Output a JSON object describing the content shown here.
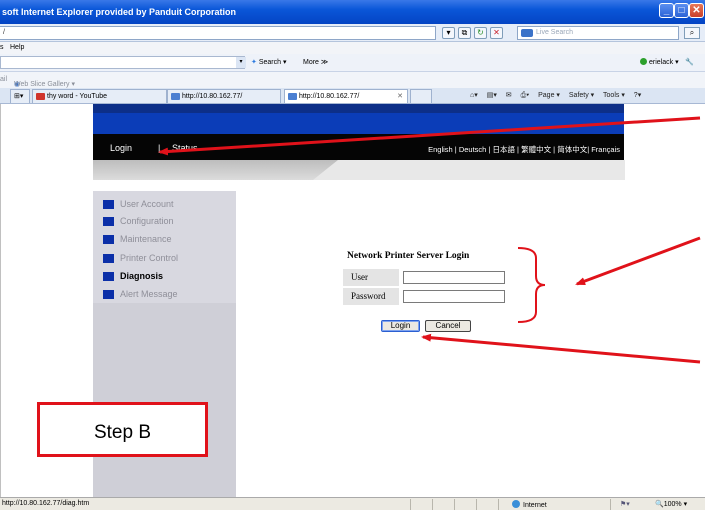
{
  "window": {
    "title": "soft Internet Explorer provided by Panduit Corporation",
    "buttons": {
      "minimize": "_",
      "maximize": "□",
      "close": "✕"
    }
  },
  "addressbar": {
    "url": "/",
    "search_placeholder": "Live Search"
  },
  "menubar": {
    "items": [
      "s",
      "Help"
    ]
  },
  "toolbar": {
    "search_label": "Search",
    "more_label": "More ≫",
    "user_label": "erielack",
    "arrow": "▾"
  },
  "favorites": {
    "items": [
      "ail",
      "Web Slice Gallery ▾"
    ]
  },
  "tabs": [
    {
      "label": "thy word - YouTube"
    },
    {
      "label": "http://10.80.162.77/"
    },
    {
      "label": "http://10.80.162.77/",
      "close": "✕"
    }
  ],
  "commandbar": {
    "items": [
      "Page ▾",
      "Safety ▾",
      "Tools ▾"
    ]
  },
  "printer_page": {
    "nav": {
      "login": "Login",
      "separator": "|",
      "status": "Status"
    },
    "languages": "English | Deutsch | 日本語 | 繁體中文 | 简体中文| Français",
    "sidebar": [
      {
        "label": "User Account",
        "active": false
      },
      {
        "label": "Configuration",
        "active": false
      },
      {
        "label": "Maintenance",
        "active": false
      },
      {
        "label": "Printer Control",
        "active": false
      },
      {
        "label": "Diagnosis",
        "active": true
      },
      {
        "label": "Alert Message",
        "active": false
      }
    ],
    "form": {
      "title": "Network Printer Server Login",
      "user_label": "User",
      "user_value": "",
      "password_label": "Password",
      "password_value": "",
      "login_button": "Login",
      "cancel_button": "Cancel"
    }
  },
  "annotation": {
    "step_label": "Step B",
    "color": "#e0121a"
  },
  "statusbar": {
    "url": "http://10.80.162.77/diag.htm",
    "zone": "Internet",
    "zoom": "100%"
  },
  "colors": {
    "title_bar": "#0a56d8",
    "printer_header_blue": "#0b3db8",
    "printer_nav_black": "#050505",
    "sidebar_square": "#0b2fa8"
  }
}
